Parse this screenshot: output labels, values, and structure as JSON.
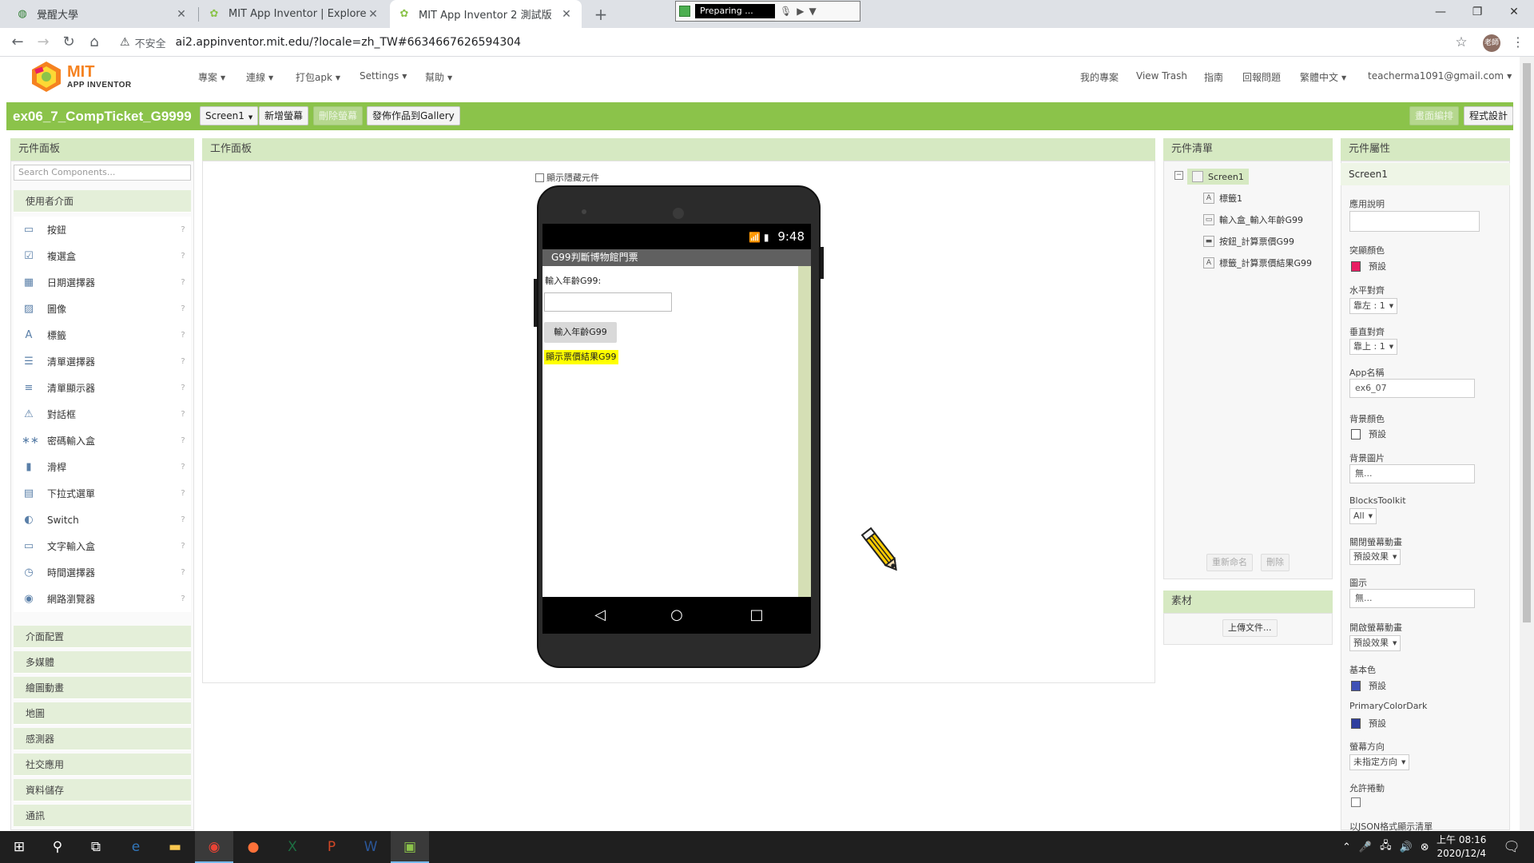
{
  "browser": {
    "tabs": [
      {
        "title": "覺醒大學",
        "icon": "globe-icon"
      },
      {
        "title": "MIT App Inventor | Explore MIT",
        "icon": "app-inventor-icon"
      },
      {
        "title": "MIT App Inventor 2 測試版",
        "icon": "app-inventor-icon"
      }
    ],
    "new_tab": "+",
    "recorder_status": "Preparing ...",
    "insecure_label": "不安全",
    "url": "ai2.appinventor.mit.edu/?locale=zh_TW#6634667626594304",
    "avatar_text": "老師"
  },
  "app": {
    "logo_text": "MIT",
    "logo_subtext": "APP INVENTOR",
    "menus": [
      "專案",
      "連線",
      "打包apk",
      "Settings",
      "幫助"
    ],
    "right_menus": [
      "我的專案",
      "View Trash",
      "指南",
      "回報問題",
      "繁體中文",
      "teacherma1091@gmail.com"
    ],
    "accent_color": "#8bc34a"
  },
  "toolbar": {
    "project_name": "ex06_7_CompTicket_G9999",
    "screen_select": "Screen1",
    "add_screen": "新增螢幕",
    "remove_screen": "刪除螢幕",
    "publish": "發佈作品到Gallery",
    "designer": "畫面編排",
    "blocks": "程式設計"
  },
  "palette": {
    "title": "元件面板",
    "search_placeholder": "Search Components...",
    "category_ui": "使用者介面",
    "items": [
      {
        "label": "按鈕",
        "icon": "button-icon"
      },
      {
        "label": "複選盒",
        "icon": "checkbox-icon"
      },
      {
        "label": "日期選擇器",
        "icon": "datepicker-icon"
      },
      {
        "label": "圖像",
        "icon": "image-icon"
      },
      {
        "label": "標籤",
        "icon": "label-icon"
      },
      {
        "label": "清單選擇器",
        "icon": "listpicker-icon"
      },
      {
        "label": "清單顯示器",
        "icon": "listview-icon"
      },
      {
        "label": "對話框",
        "icon": "notifier-icon"
      },
      {
        "label": "密碼輸入盒",
        "icon": "password-icon"
      },
      {
        "label": "滑桿",
        "icon": "slider-icon"
      },
      {
        "label": "下拉式選單",
        "icon": "spinner-icon"
      },
      {
        "label": "Switch",
        "icon": "switch-icon"
      },
      {
        "label": "文字輸入盒",
        "icon": "textbox-icon"
      },
      {
        "label": "時間選擇器",
        "icon": "timepicker-icon"
      },
      {
        "label": "網路瀏覽器",
        "icon": "webviewer-icon"
      }
    ],
    "help": "?",
    "categories": [
      "介面配置",
      "多媒體",
      "繪圖動畫",
      "地圖",
      "感測器",
      "社交應用",
      "資料儲存",
      "通訊"
    ]
  },
  "viewer": {
    "title": "工作面板",
    "show_hidden": "顯示隱藏元件",
    "phone": {
      "time": "9:48",
      "app_title": "G99判斷博物館門票",
      "label_age": "輸入年齡G99:",
      "button_text": "輸入年齡G99",
      "result_label": "顯示票價結果G99"
    }
  },
  "components": {
    "title": "元件清單",
    "tree": {
      "root": "Screen1",
      "children": [
        {
          "label": "標籤1",
          "icon": "label-icon"
        },
        {
          "label": "輸入盒_輸入年齡G99",
          "icon": "textbox-icon"
        },
        {
          "label": "按鈕_計算票價G99",
          "icon": "button-icon"
        },
        {
          "label": "標籤_計算票價結果G99",
          "icon": "label-icon"
        }
      ]
    },
    "rename": "重新命名",
    "delete": "刪除",
    "media_title": "素材",
    "upload": "上傳文件..."
  },
  "properties": {
    "title": "元件屬性",
    "component": "Screen1",
    "about_label": "應用說明",
    "accent_label": "突顯顏色",
    "accent_value": "預設",
    "accent_color": "#e91e63",
    "halign_label": "水平對齊",
    "halign_value": "靠左 : 1",
    "valign_label": "垂直對齊",
    "valign_value": "靠上 : 1",
    "appname_label": "App名稱",
    "appname_value": "ex6_07",
    "bgcolor_label": "背景顏色",
    "bgcolor_value": "預設",
    "bgcolor_color": "#ffffff",
    "bgimage_label": "背景圖片",
    "bgimage_value": "無...",
    "blocks_toolkit_label": "BlocksToolkit",
    "blocks_toolkit_value": "All",
    "close_anim_label": "關閉螢幕動畫",
    "close_anim_value": "預設效果",
    "icon_label": "圖示",
    "icon_value": "無...",
    "open_anim_label": "開啟螢幕動畫",
    "open_anim_value": "預設效果",
    "primary_label": "基本色",
    "primary_value": "預設",
    "primary_color": "#3f51b5",
    "primary_dark_label": "PrimaryColorDark",
    "primary_dark_value": "預設",
    "primary_dark_color": "#303f9f",
    "orientation_label": "螢幕方向",
    "orientation_value": "未指定方向",
    "scrollable_label": "允許捲動",
    "json_label": "以JSON格式顯示清單"
  },
  "taskbar": {
    "clock_time": "上午 08:16",
    "clock_date": "2020/12/4",
    "apps": [
      "start-icon",
      "search-icon",
      "task-view-icon",
      "edge-icon",
      "file-explorer-icon",
      "chrome-icon",
      "firefox-icon",
      "excel-icon",
      "powerpoint-icon",
      "word-icon",
      "app-icon"
    ]
  }
}
